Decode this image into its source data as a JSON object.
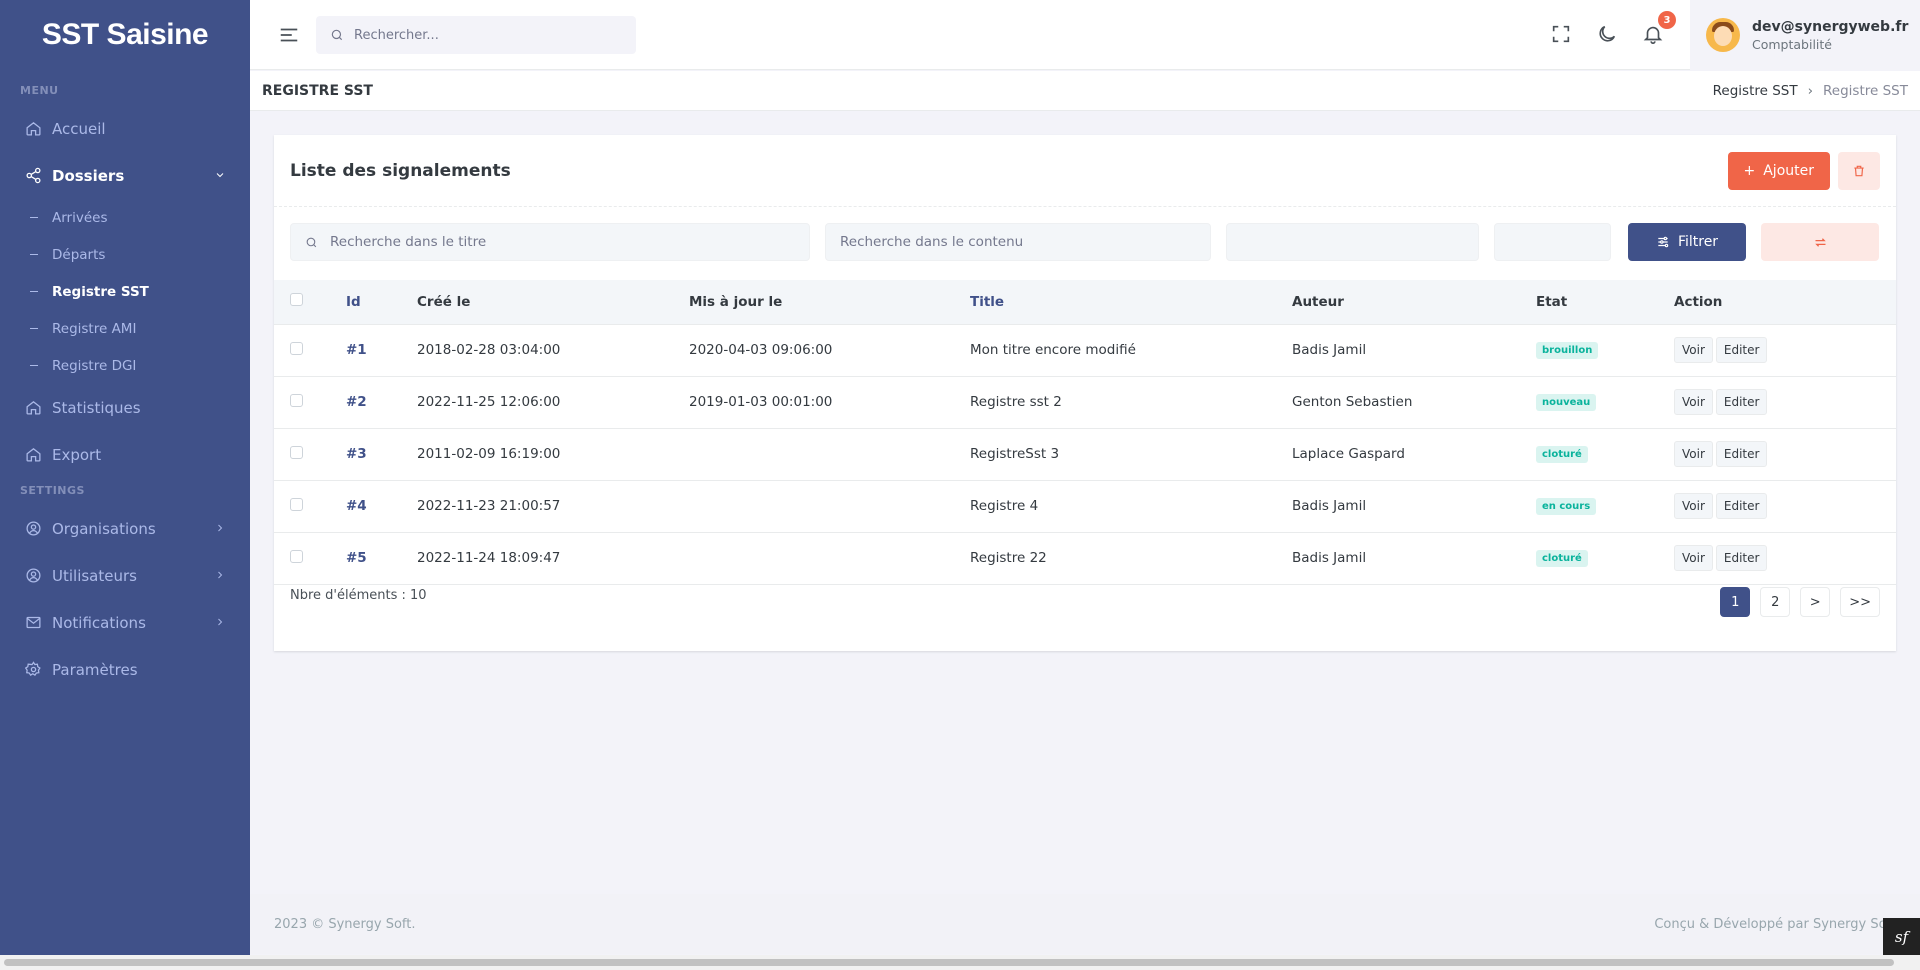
{
  "app": {
    "brand": "SST Saisine"
  },
  "sidebar": {
    "menu_title": "MENU",
    "settings_title": "SETTINGS",
    "items": [
      {
        "label": "Accueil",
        "icon": "home-icon"
      },
      {
        "label": "Dossiers",
        "icon": "share-icon"
      },
      {
        "label": "Statistiques",
        "icon": "home-icon"
      },
      {
        "label": "Export",
        "icon": "home-icon"
      }
    ],
    "sub_items": [
      "Arrivées",
      "Départs",
      "Registre SST",
      "Registre AMI",
      "Registre DGI"
    ],
    "settings_items": [
      {
        "label": "Organisations",
        "icon": "user-circle-icon"
      },
      {
        "label": "Utilisateurs",
        "icon": "user-circle-icon"
      },
      {
        "label": "Notifications",
        "icon": "mail-icon"
      },
      {
        "label": "Paramètres",
        "icon": "gear-icon"
      }
    ]
  },
  "topbar": {
    "search_placeholder": "Rechercher...",
    "notifications_count": "3",
    "user_email": "dev@synergyweb.fr",
    "user_role": "Comptabilité"
  },
  "page": {
    "title": "REGISTRE SST",
    "breadcrumb": [
      "Registre SST",
      "Registre SST"
    ]
  },
  "card": {
    "title": "Liste des signalements",
    "add_label": "Ajouter",
    "filter_title_placeholder": "Recherche dans le titre",
    "filter_content_placeholder": "Recherche dans le contenu",
    "filter_label": "Filtrer"
  },
  "table": {
    "headers": {
      "id": "Id",
      "created": "Créé le",
      "updated": "Mis à jour le",
      "title": "Title",
      "author": "Auteur",
      "state": "Etat",
      "action": "Action"
    },
    "rows": [
      {
        "id": "#1",
        "created": "2018-02-28 03:04:00",
        "updated": "2020-04-03 09:06:00",
        "title": "Mon titre encore modifié",
        "author": "Badis Jamil",
        "state": "brouillon"
      },
      {
        "id": "#2",
        "created": "2022-11-25 12:06:00",
        "updated": "2019-01-03 00:01:00",
        "title": "Registre sst 2",
        "author": "Genton Sebastien",
        "state": "nouveau"
      },
      {
        "id": "#3",
        "created": "2011-02-09 16:19:00",
        "updated": "",
        "title": "RegistreSst 3",
        "author": "Laplace Gaspard",
        "state": "cloturé"
      },
      {
        "id": "#4",
        "created": "2022-11-23 21:00:57",
        "updated": "",
        "title": "Registre 4",
        "author": "Badis Jamil",
        "state": "en cours"
      },
      {
        "id": "#5",
        "created": "2022-11-24 18:09:47",
        "updated": "",
        "title": "Registre 22",
        "author": "Badis Jamil",
        "state": "cloturé"
      }
    ],
    "view_label": "Voir",
    "edit_label": "Editer",
    "count_label": "Nbre d'éléments : 10"
  },
  "pagination": {
    "pages": [
      "1",
      "2"
    ],
    "next": ">",
    "last": ">>",
    "current": "1"
  },
  "footer": {
    "left": "2023 © Synergy Soft.",
    "right": "Conçu & Développé par Synergy Soft"
  },
  "colors": {
    "sidebar": "#405189",
    "accent": "#f06548",
    "primary": "#405189",
    "success": "#0ab39c"
  }
}
